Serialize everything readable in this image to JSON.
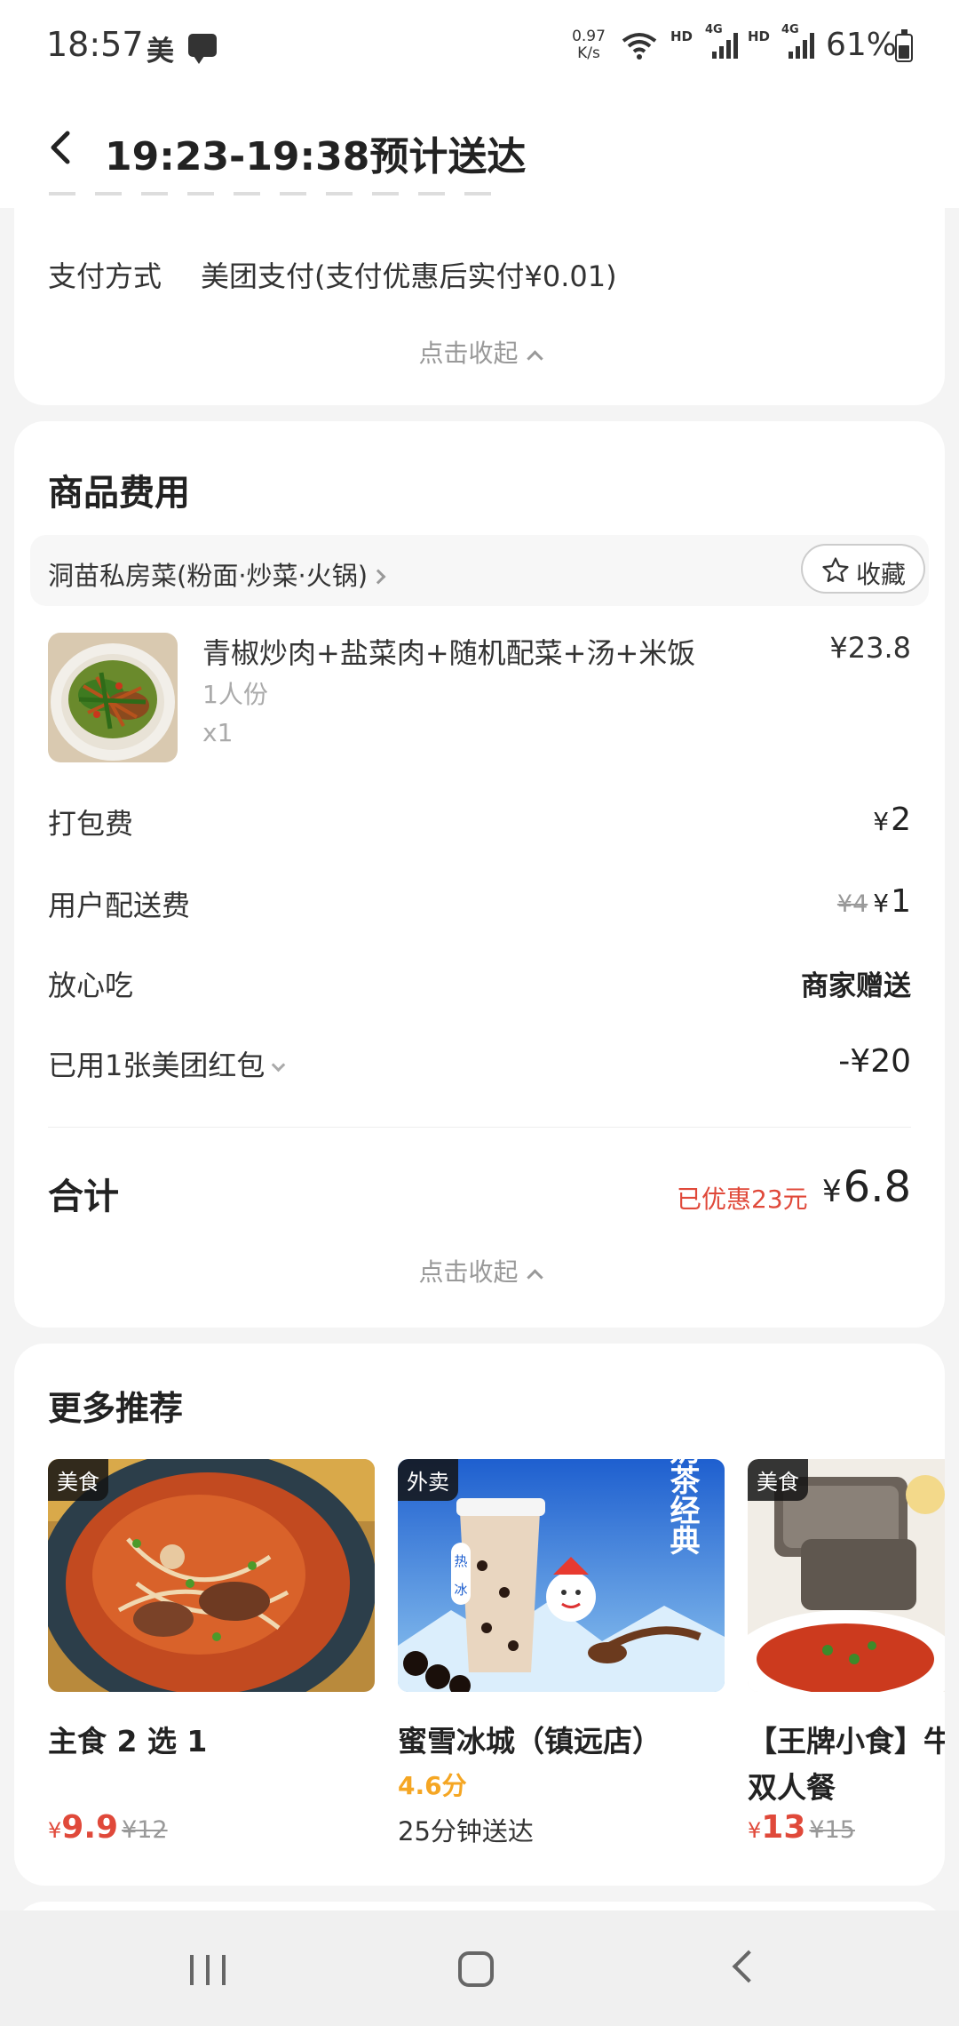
{
  "status_bar": {
    "time": "18:57",
    "app_badge": "美",
    "speed_value": "0.97",
    "speed_unit": "K/s",
    "hd_1": "HD",
    "net_1": "4G",
    "hd_2": "HD",
    "net_2": "4G",
    "battery": "61%"
  },
  "header": {
    "title": "19:23-19:38预计送达"
  },
  "payment": {
    "label": "支付方式",
    "value": "美团支付(支付优惠后实付¥0.01)",
    "collapse_label": "点击收起"
  },
  "goods": {
    "section_title": "商品费用",
    "shop_name": "洞苗私房菜(粉面·炒菜·火锅)",
    "favorite_label": "收藏",
    "item": {
      "name": "青椒炒肉+盐菜肉+随机配菜+汤+米饭",
      "spec": "1人份",
      "qty": "x1",
      "price": "¥23.8"
    },
    "fees": {
      "packing_label": "打包费",
      "packing_yen": "¥",
      "packing_value": "2",
      "delivery_label": "用户配送费",
      "delivery_original": "¥4",
      "delivery_yen": "¥",
      "delivery_value": "1",
      "safe_label": "放心吃",
      "safe_value": "商家赠送",
      "coupon_label": "已用1张美团红包",
      "coupon_value": "-¥20"
    },
    "total": {
      "label": "合计",
      "discount": "已优惠23元",
      "yen": "¥",
      "value": "6.8"
    },
    "collapse_label": "点击收起"
  },
  "recommend": {
    "section_title": "更多推荐",
    "items": [
      {
        "tag": "美食",
        "name": "主食 2 选 1",
        "yen": "¥",
        "price": "9.9",
        "original": "¥12"
      },
      {
        "tag": "外卖",
        "name": "蜜雪冰城（镇远店）",
        "score": "4.6分",
        "eta": "25分钟送达",
        "poster_title": "奶茶经典",
        "poster_hot": "热",
        "poster_ice": "冰"
      },
      {
        "tag": "美食",
        "name_line1": "【王牌小食】牛",
        "name_line2": "双人餐",
        "yen": "¥",
        "price": "13",
        "original": "¥15"
      }
    ]
  },
  "colors": {
    "accent_red": "#e0493a",
    "score_orange": "#f5a623"
  }
}
